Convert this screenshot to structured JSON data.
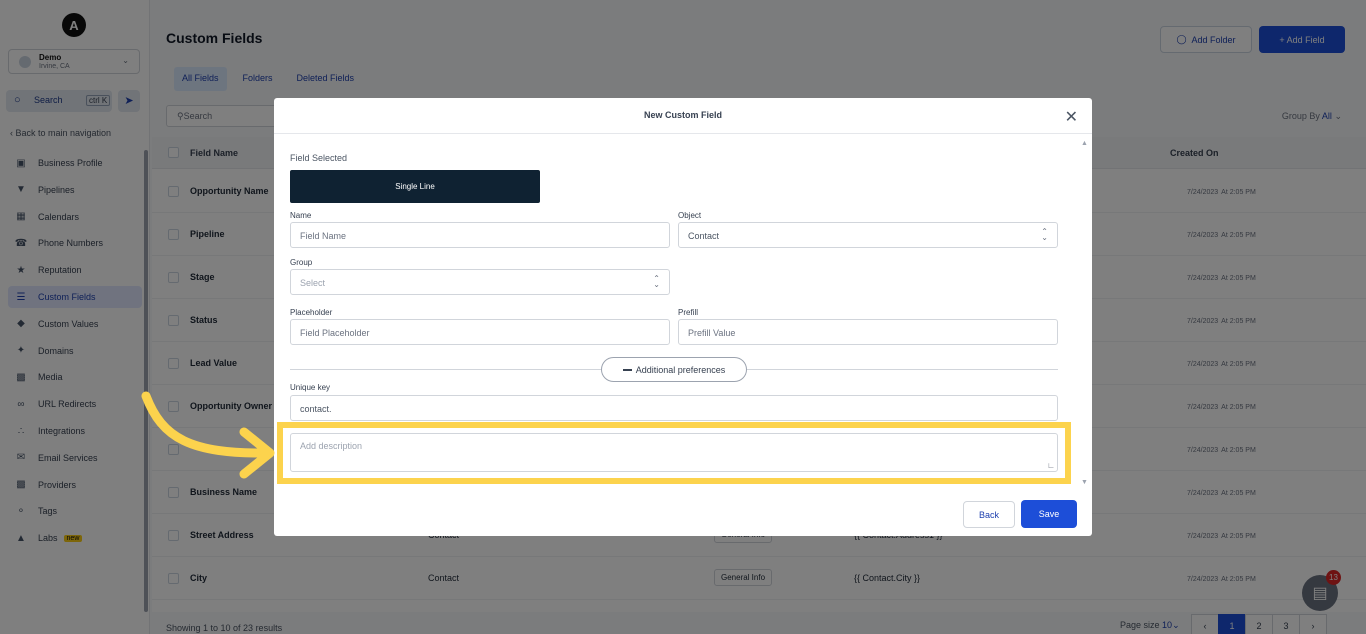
{
  "sidebar": {
    "logo": "A",
    "account": {
      "name": "Demo",
      "location": "Irvine, CA"
    },
    "search": {
      "label": "Search",
      "shortcut": "ctrl K"
    },
    "back_label": "Back to main navigation",
    "items": [
      {
        "label": "Business Profile",
        "icon": "briefcase-icon"
      },
      {
        "label": "Pipelines",
        "icon": "funnel-icon"
      },
      {
        "label": "Calendars",
        "icon": "calendar-icon"
      },
      {
        "label": "Phone Numbers",
        "icon": "phone-icon"
      },
      {
        "label": "Reputation",
        "icon": "star-icon"
      },
      {
        "label": "Custom Fields",
        "icon": "fields-icon",
        "active": true
      },
      {
        "label": "Custom Values",
        "icon": "diamond-icon"
      },
      {
        "label": "Domains",
        "icon": "globe-icon"
      },
      {
        "label": "Media",
        "icon": "image-icon"
      },
      {
        "label": "URL Redirects",
        "icon": "link-icon"
      },
      {
        "label": "Integrations",
        "icon": "plug-icon"
      },
      {
        "label": "Email Services",
        "icon": "mail-icon"
      },
      {
        "label": "Providers",
        "icon": "lock-icon"
      },
      {
        "label": "Tags",
        "icon": "tag-icon"
      },
      {
        "label": "Labs",
        "icon": "flask-icon",
        "badge": "new"
      }
    ]
  },
  "header": {
    "title": "Custom Fields",
    "add_folder": "Add Folder",
    "add_field": "+ Add Field"
  },
  "tabs": [
    {
      "label": "All Fields",
      "active": true
    },
    {
      "label": "Folders"
    },
    {
      "label": "Deleted Fields"
    }
  ],
  "list": {
    "search_placeholder": "Search",
    "group_by_label": "Group By",
    "group_by_value": "All"
  },
  "table": {
    "columns": {
      "name": "Field Name",
      "created": "Created On"
    },
    "rows": [
      {
        "name": "Opportunity Name",
        "date": "7/24/2023",
        "time": "At 2:05 PM"
      },
      {
        "name": "Pipeline",
        "date": "7/24/2023",
        "time": "At 2:05 PM"
      },
      {
        "name": "Stage",
        "date": "7/24/2023",
        "time": "At 2:05 PM"
      },
      {
        "name": "Status",
        "date": "7/24/2023",
        "time": "At 2:05 PM"
      },
      {
        "name": "Lead Value",
        "date": "7/24/2023",
        "time": "At 2:05 PM"
      },
      {
        "name": "Opportunity Owner",
        "date": "7/24/2023",
        "time": "At 2:05 PM"
      },
      {
        "name": "",
        "date": "7/24/2023",
        "time": "At 2:05 PM"
      },
      {
        "name": "Business Name",
        "date": "7/24/2023",
        "time": "At 2:05 PM"
      },
      {
        "name": "Street Address",
        "object": "Contact",
        "folder": "General Info",
        "key": "{{ Contact.Address1 }}",
        "date": "7/24/2023",
        "time": "At 2:05 PM"
      },
      {
        "name": "City",
        "object": "Contact",
        "folder": "General Info",
        "key": "{{ Contact.City }}",
        "date": "7/24/2023",
        "time": "At 2:05 PM"
      }
    ],
    "footer": "Showing 1 to 10 of 23 results",
    "page_size_label": "Page size",
    "page_size": "10",
    "pages": [
      "1",
      "2",
      "3"
    ]
  },
  "chat_badge": "13",
  "modal": {
    "title": "New Custom Field",
    "field_selected_label": "Field Selected",
    "field_type": "Single Line",
    "name_label": "Name",
    "name_placeholder": "Field Name",
    "object_label": "Object",
    "object_value": "Contact",
    "group_label": "Group",
    "group_placeholder": "Select",
    "placeholder_label": "Placeholder",
    "placeholder_placeholder": "Field Placeholder",
    "prefill_label": "Prefill",
    "prefill_placeholder": "Prefill Value",
    "additional_label": "Additional preferences",
    "unique_key_label": "Unique key",
    "unique_key_value": "contact.",
    "description_placeholder": "Add description",
    "back": "Back",
    "save": "Save"
  },
  "colors": {
    "accent": "#1d4ed8",
    "highlight": "#fcd34d",
    "selected_card": "#0f2232"
  }
}
